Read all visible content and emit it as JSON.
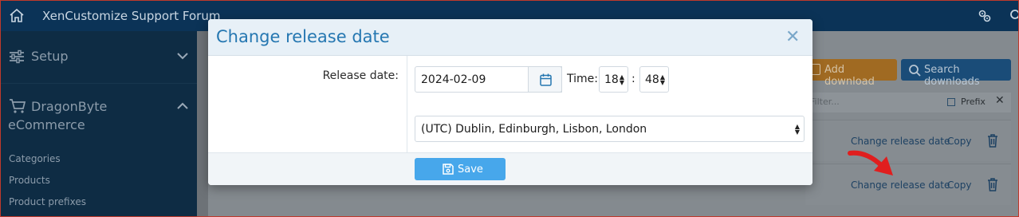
{
  "topbar": {
    "title": "XenCustomize Support Forum",
    "icons": [
      "home-icon",
      "gears-icon",
      "search-icon"
    ]
  },
  "sidebar": {
    "setup_label": "Setup",
    "ecommerce_label": "DragonByte eCommerce",
    "links": [
      "Categories",
      "Products",
      "Product prefixes"
    ]
  },
  "main": {
    "add_download_label": "Add download",
    "search_downloads_label": "Search downloads",
    "filter_placeholder": "Filter...",
    "prefix_label": "Prefix",
    "rows": [
      {
        "action_label": "Change release date",
        "copy_label": "Copy"
      },
      {
        "action_label": "Change release date",
        "copy_label": "Copy"
      }
    ]
  },
  "modal": {
    "title": "Change release date",
    "release_date_label": "Release date:",
    "date_value": "2024-02-09",
    "time_label": "Time:",
    "hour_value": "18",
    "minute_value": "48",
    "time_separator": ":",
    "timezone_value": "(UTC) Dublin, Edinburgh, Lisbon, London",
    "save_label": "Save"
  },
  "colors": {
    "topbar": "#0b3357",
    "modal_title": "#2577b1",
    "save_button": "#47a7eb",
    "add_download_button": "#a06a22",
    "search_downloads_button": "#1a4c78",
    "annotation_arrow": "#e01e1e"
  }
}
